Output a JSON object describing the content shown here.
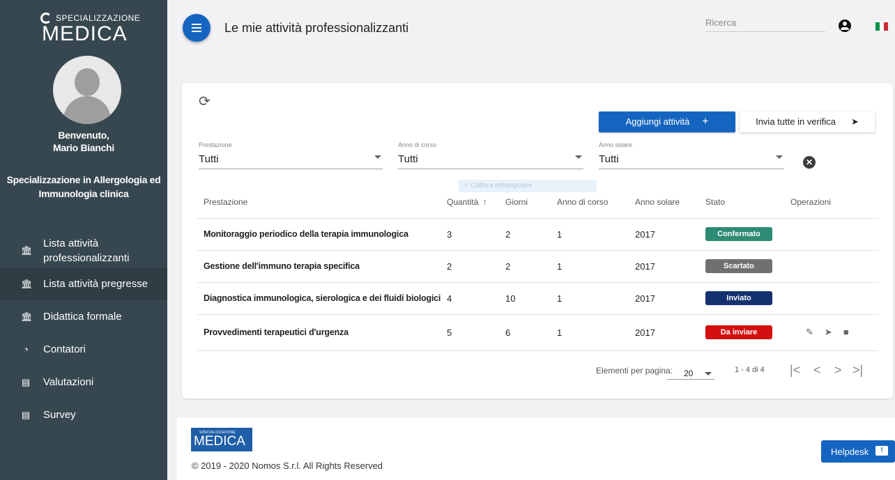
{
  "brand": {
    "top": "SPECIALIZZAZIONE",
    "name": "MEDICA"
  },
  "sidebar": {
    "welcome": "Benvenuto,",
    "user_name": "Mario Bianchi",
    "specialization_line1": "Specializzazione in Allergologia ed",
    "specialization_line2": "Immunologia clinica",
    "items": [
      {
        "label_line1": "Lista attività",
        "label_line2": "professionalizzanti",
        "icon": "bank-icon"
      },
      {
        "label": "Lista attività pregresse",
        "icon": "bank-icon",
        "active": true
      },
      {
        "label": "Didattica formale",
        "icon": "bank-icon"
      },
      {
        "label": "Contatori",
        "icon": "gauge-icon"
      },
      {
        "label": "Valutazioni",
        "icon": "clipboard-icon"
      },
      {
        "label": "Survey",
        "icon": "clipboard-icon"
      }
    ]
  },
  "header": {
    "title": "Le mie attività professionalizzanti",
    "search_placeholder": "Ricerca"
  },
  "toolbar": {
    "add_label": "Aggiungi attività",
    "add_icon": "+",
    "send_all_label": "Invia tutte in verifica",
    "send_icon": "➤"
  },
  "filters": [
    {
      "label": "Prestazione",
      "value": "Tutti"
    },
    {
      "label": "Anno di corso",
      "value": "Tutti"
    },
    {
      "label": "Anno solare",
      "value": "Tutti"
    }
  ],
  "ghost_tooltip": "×  Cattura rettangolare",
  "table": {
    "columns": [
      "Prestazione",
      "Quantità",
      "Giorni",
      "Anno di corso",
      "Anno solare",
      "Stato",
      "Operazioni"
    ],
    "sort_indicator": "↑",
    "rows": [
      {
        "prestazione": "Monitoraggio periodico della terapia immunologica",
        "quantita": "3",
        "giorni": "2",
        "anno_corso": "1",
        "anno_solare": "2017",
        "stato": "Confermato",
        "stato_color": "#2e8b74"
      },
      {
        "prestazione": "Gestione dell'immuno terapia specifica",
        "quantita": "2",
        "giorni": "2",
        "anno_corso": "1",
        "anno_solare": "2017",
        "stato": "Scartato",
        "stato_color": "#707070"
      },
      {
        "prestazione": "Diagnostica immunologica, sierologica e dei fluidi biologici",
        "quantita": "4",
        "giorni": "10",
        "anno_corso": "1",
        "anno_solare": "2017",
        "stato": "Inviato",
        "stato_color": "#14306e"
      },
      {
        "prestazione": "Provvedimenti terapeutici d'urgenza",
        "quantita": "5",
        "giorni": "6",
        "anno_corso": "1",
        "anno_solare": "2017",
        "stato": "Da inviare",
        "stato_color": "#d40f0f"
      }
    ]
  },
  "pagination": {
    "per_page_label": "Elementi per pagina:",
    "per_page_value": "20",
    "range": "1 - 4 di 4",
    "first": "|<",
    "prev": "<",
    "next": ">",
    "last": ">|"
  },
  "footer": {
    "copyright": "© 2019 - 2020 Nomos S.r.l. All Rights Reserved",
    "helpdesk_label": "Helpdesk"
  },
  "flag_colors": [
    "#009246",
    "#ffffff",
    "#ce2b37"
  ]
}
